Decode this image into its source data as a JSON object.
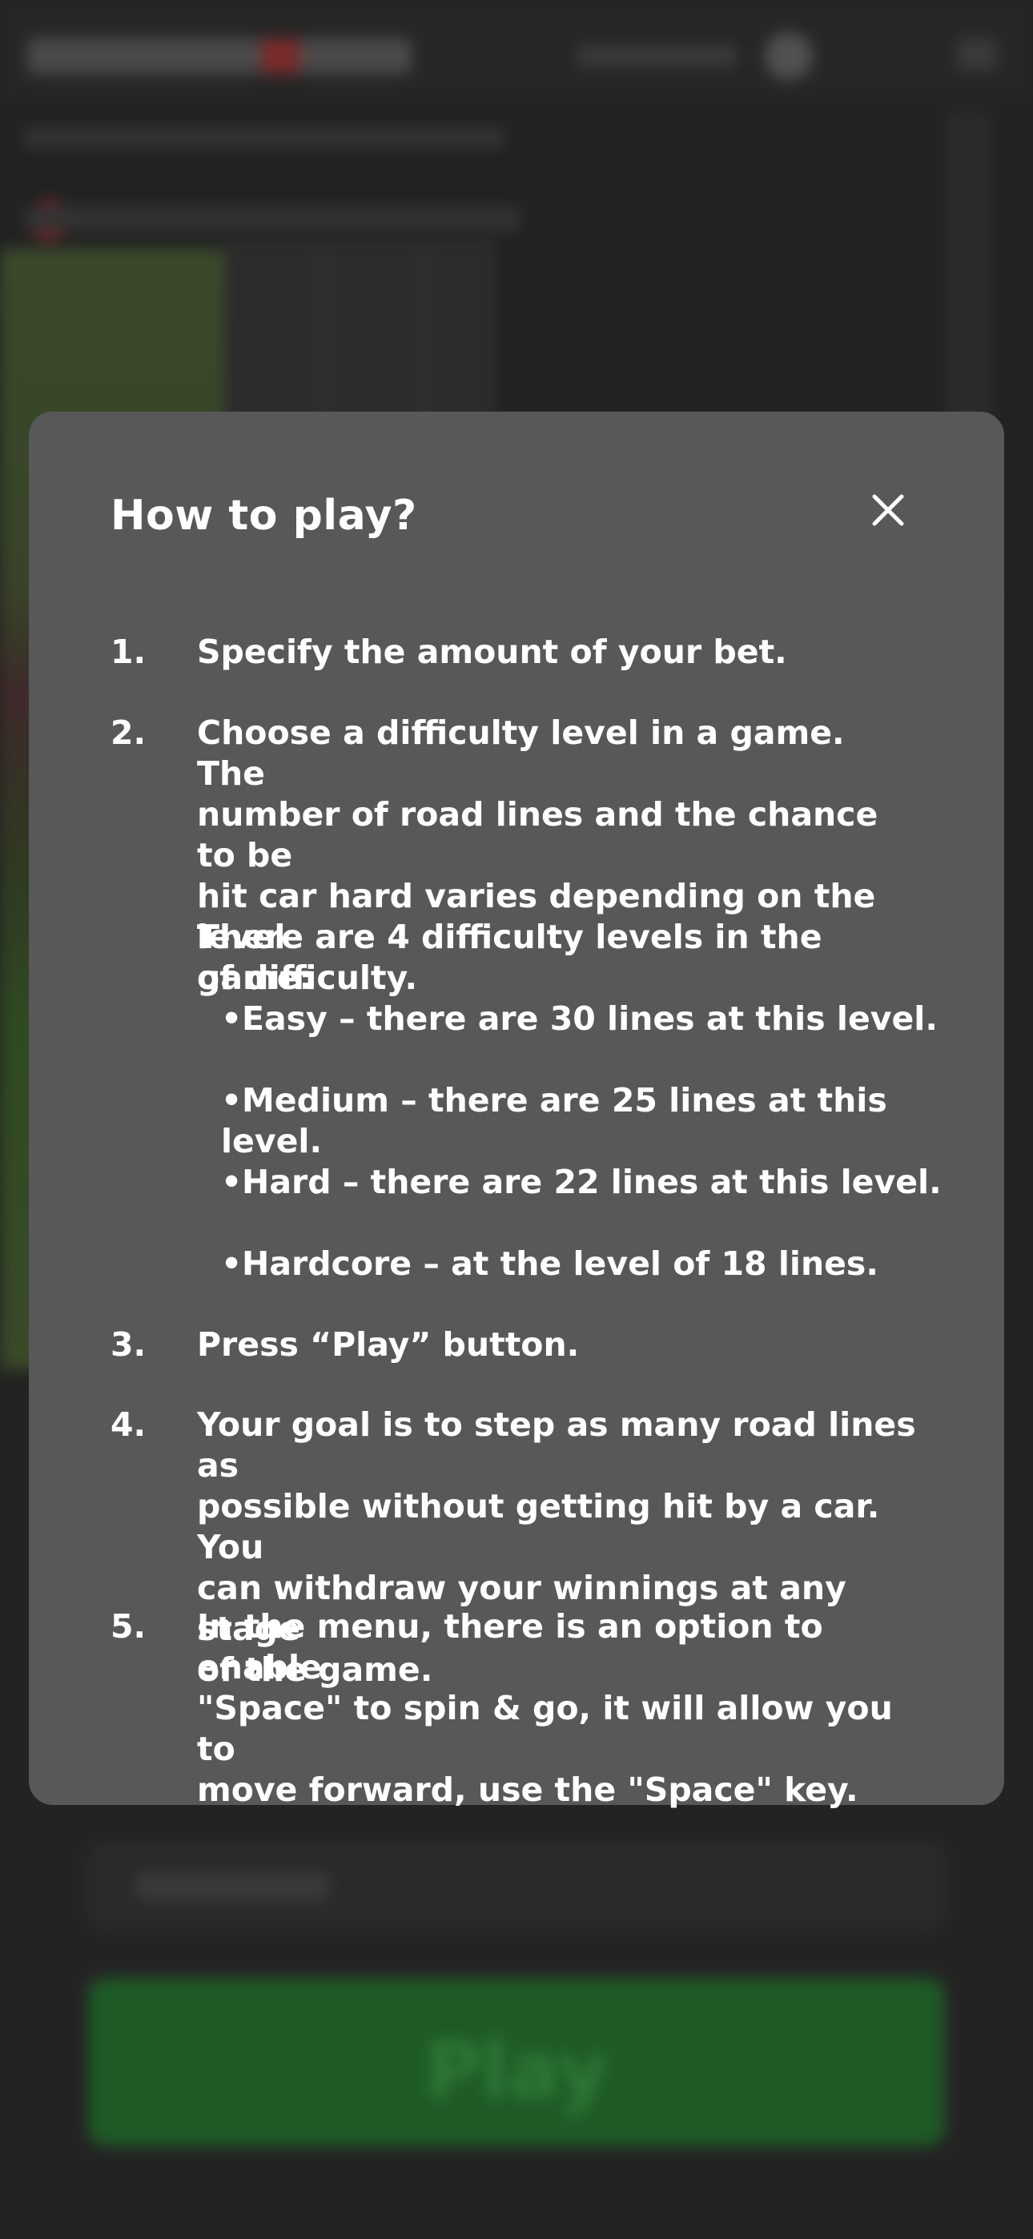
{
  "background": {
    "play_label": "Play"
  },
  "modal": {
    "title": "How to play?",
    "close_icon": "close-icon",
    "steps": [
      {
        "num": "1.",
        "lines": [
          "Specify the amount of your bet."
        ]
      },
      {
        "num": "2.",
        "lines": [
          "Choose a difficulty level in a game. The",
          "number of road lines and the chance to be",
          "hit car hard varies depending on the level",
          "of difficulty."
        ],
        "subtitle": "There are 4 difficulty levels in the game:",
        "bullets": [
          "Easy – there are 30 lines at this level.",
          "Medium – there are 25 lines at this level.",
          "Hard – there are 22 lines at this level.",
          "Hardcore – at the level of 18 lines."
        ]
      },
      {
        "num": "3.",
        "lines": [
          "Press  “Play” button."
        ]
      },
      {
        "num": "4.",
        "lines": [
          "Your goal is to step as many road lines as",
          "possible without getting hit by a car. You",
          "can withdraw your winnings at any stage",
          "of the game."
        ]
      },
      {
        "num": "5.",
        "lines": [
          "In the menu, there is an option to enable",
          "\"Space\" to spin & go, it will allow you to",
          "move forward, use the \"Space\" key."
        ]
      }
    ]
  }
}
